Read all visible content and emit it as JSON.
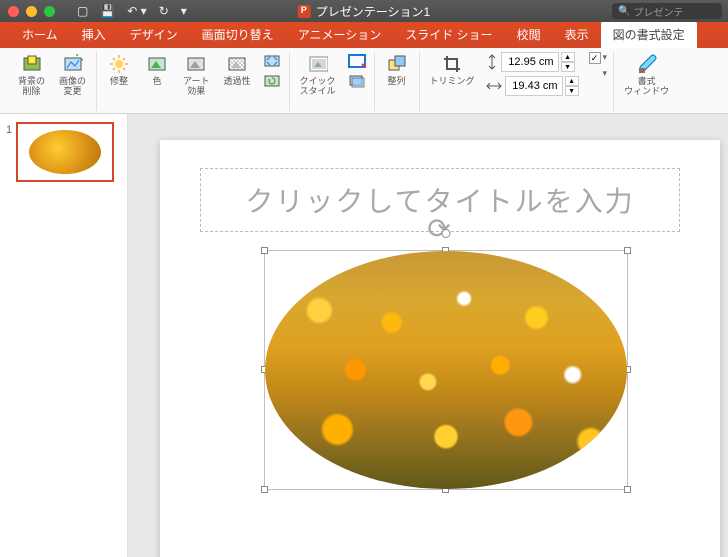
{
  "window": {
    "title": "プレゼンテーション1"
  },
  "search": {
    "placeholder": "プレゼンテ"
  },
  "tabs": {
    "home": "ホーム",
    "insert": "挿入",
    "design": "デザイン",
    "transition": "画面切り替え",
    "animation": "アニメーション",
    "slideshow": "スライド ショー",
    "review": "校閲",
    "view": "表示",
    "pictureformat": "図の書式設定"
  },
  "ribbon": {
    "removebg": "背景の\n削除",
    "changepic": "画像の\n変更",
    "correct": "修整",
    "color": "色",
    "arteffect": "アート\n効果",
    "transparent": "透過性",
    "quickstyle": "クイック\nスタイル",
    "arrange": "整列",
    "crop": "トリミング",
    "height": "12.95 cm",
    "width": "19.43 cm",
    "formatpane": "書式\nウィンドウ"
  },
  "slide": {
    "number": "1",
    "title_placeholder": "クリックしてタイトルを入力"
  }
}
